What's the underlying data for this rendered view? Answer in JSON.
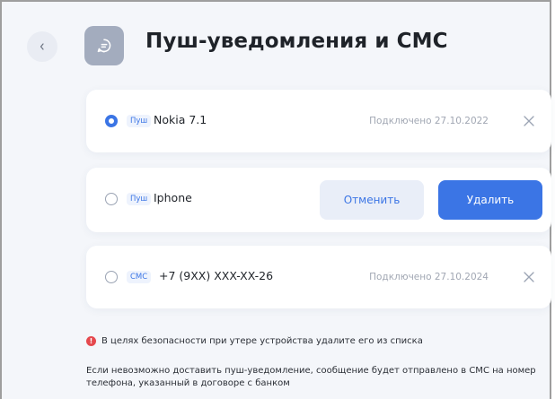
{
  "header": {
    "title": "Пуш-уведомления и СМС",
    "back_icon": "chevron-left-icon",
    "title_icon": "message-icon"
  },
  "devices": [
    {
      "selected": true,
      "tag": "Пуш",
      "name": "Nokia 7.1",
      "status": "Подключено 27.10.2022"
    },
    {
      "selected": false,
      "tag": "Пуш",
      "name": "Iphone",
      "cancel_label": "Отменить",
      "delete_label": "Удалить"
    },
    {
      "selected": false,
      "tag": "СМС",
      "name": "+7 (9XX) XXX-XX-26",
      "status": "Подключено 27.10.2024"
    }
  ],
  "warning": {
    "text": "В целях безопасности при утере устройства удалите его из списка"
  },
  "info": {
    "text": "Если невозможно доставить пуш-уведомление, сообщение будет отправлено в СМС на номер телефона, указанный в договоре с банком"
  },
  "colors": {
    "accent": "#3b75e5",
    "background": "#f4f6fa",
    "danger": "#e5484d",
    "icon_tile": "#a3acbe"
  }
}
